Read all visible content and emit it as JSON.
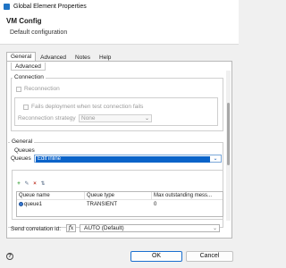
{
  "window": {
    "title": "Global Element Properties"
  },
  "banner": {
    "title": "VM Config",
    "description": "Default configuration"
  },
  "tabs": [
    {
      "label": "General",
      "active": true
    },
    {
      "label": "Advanced",
      "active": false
    },
    {
      "label": "Notes",
      "active": false
    },
    {
      "label": "Help",
      "active": false
    }
  ],
  "subtab": {
    "label": "Advanced"
  },
  "connection": {
    "legend": "Connection",
    "reconnection_label": "Reconnection",
    "fails_deployment_label": "Fails deployment when test connection fails",
    "strategy_label": "Reconnection strategy",
    "strategy_value": "None"
  },
  "general": {
    "legend": "General",
    "queues_heading": "Queues",
    "queues_label": "Queues",
    "queues_value": "Edit inline"
  },
  "queue_table": {
    "columns": [
      "Queue name",
      "Queue type",
      "Max outstanding mess..."
    ],
    "rows": [
      {
        "name": "queue1",
        "type": "TRANSIENT",
        "max": "0"
      }
    ]
  },
  "correlation": {
    "label": "Send correlation id:",
    "fx": "fx",
    "value": "AUTO (Default)"
  },
  "footer": {
    "ok_label": "OK",
    "cancel_label": "Cancel",
    "help_glyph": "?"
  },
  "icons": {
    "add": "plus-icon",
    "edit": "edit-icon",
    "delete": "delete-icon",
    "move": "move-icon"
  },
  "colors": {
    "accent": "#0a63c9",
    "add_icon": "#2e9b2e",
    "delete_icon": "#c0392b"
  }
}
